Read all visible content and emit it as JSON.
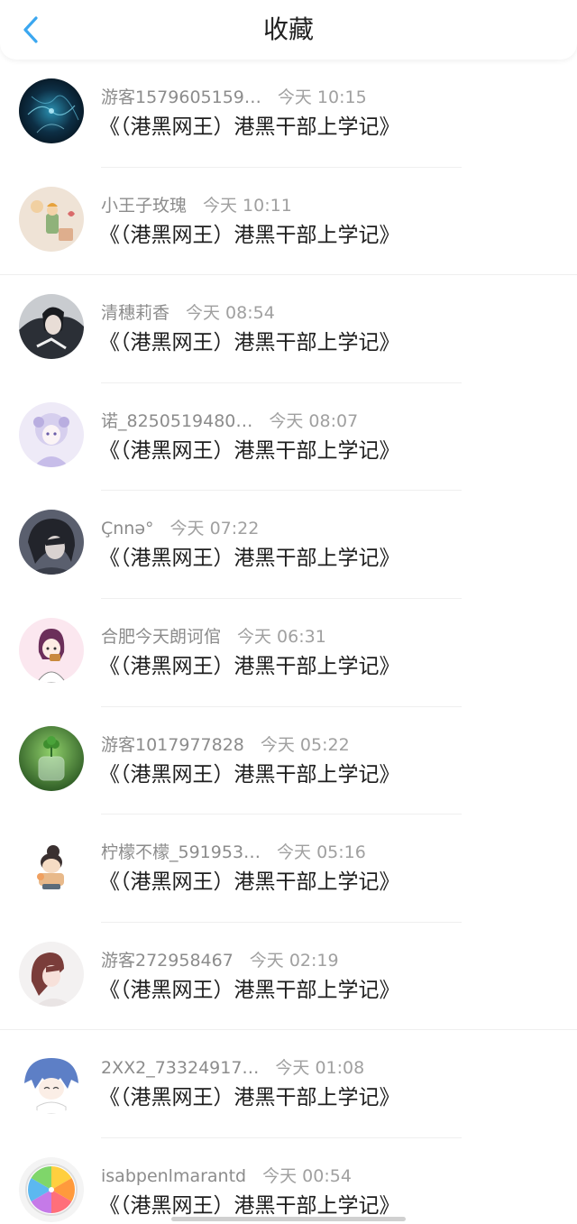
{
  "header": {
    "title": "收藏"
  },
  "colors": {
    "accent": "#3ba7f0",
    "meta_text": "#8c8c8c",
    "title_text": "#1e1e1e"
  },
  "items": [
    {
      "name": "游客1579605159…",
      "time": "今天 10:15",
      "book": "《（港黑网王）港黑干部上学记》",
      "avatar": "galaxy-avatar"
    },
    {
      "name": "小王子玫瑰",
      "time": "今天 10:11",
      "book": "《（港黑网王）港黑干部上学记》",
      "avatar": "little-prince-avatar"
    },
    {
      "name": "清穗莉香",
      "time": "今天 08:54",
      "book": "《（港黑网王）港黑干部上学记》",
      "avatar": "anime-boy-avatar"
    },
    {
      "name": "诺_8250519480…",
      "time": "今天 08:07",
      "book": "《（港黑网王）港黑干部上学记》",
      "avatar": "lilac-girl-avatar"
    },
    {
      "name": "Çnnə°",
      "time": "今天 07:22",
      "book": "《（港黑网王）港黑干部上学记》",
      "avatar": "dark-hair-avatar"
    },
    {
      "name": "合肥今天朗诃倌",
      "time": "今天 06:31",
      "book": "《（港黑网王）港黑干部上学记》",
      "avatar": "cartoon-girl-avatar"
    },
    {
      "name": "游客1017977828",
      "time": "今天 05:22",
      "book": "《（港黑网王）港黑干部上学记》",
      "avatar": "plant-jar-avatar"
    },
    {
      "name": "柠檬不檬_591953…",
      "time": "今天 05:16",
      "book": "《（港黑网王）港黑干部上学记》",
      "avatar": "chibi-avatar"
    },
    {
      "name": "游客272958467",
      "time": "今天 02:19",
      "book": "《（港黑网王）港黑干部上学记》",
      "avatar": "redhair-girl-avatar"
    },
    {
      "name": "2XX2_73324917…",
      "time": "今天 01:08",
      "book": "《（港黑网王）港黑干部上学记》",
      "avatar": "blue-hair-avatar"
    },
    {
      "name": "isabpenlmarantd",
      "time": "今天 00:54",
      "book": "《（港黑网王）港黑干部上学记》",
      "avatar": "citrus-avatar"
    }
  ]
}
